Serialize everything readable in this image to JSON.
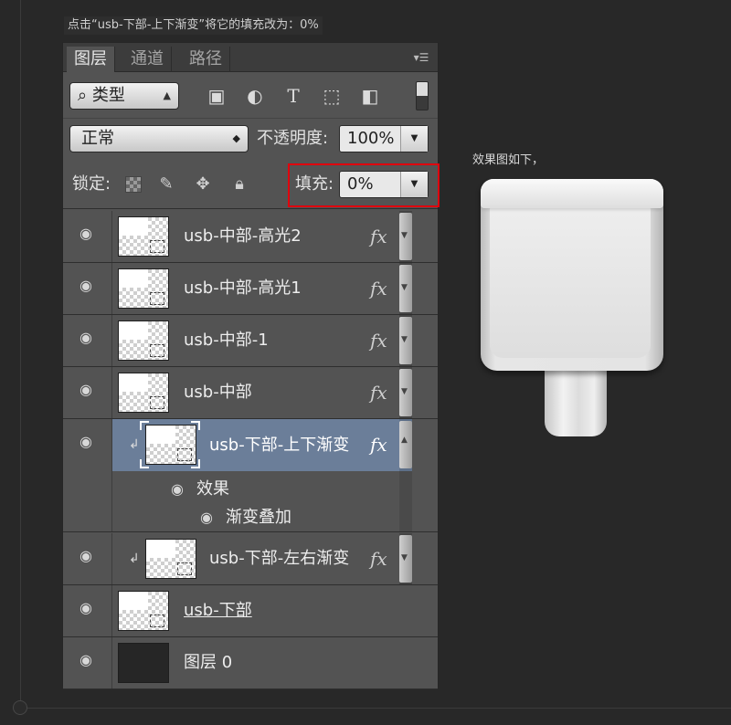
{
  "caption": "点击“usb-下部-上下渐变”将它的填充改为：0%",
  "panel": {
    "tabs": [
      "图层",
      "通道",
      "路径"
    ],
    "filter_kind": "类型",
    "blend_mode": "正常",
    "opacity_label": "不透明度:",
    "opacity_value": "100%",
    "lock_label": "锁定:",
    "fill_label": "填充:",
    "fill_value": "0%"
  },
  "layers": [
    {
      "name": "usb-中部-高光2",
      "fx": "fx"
    },
    {
      "name": "usb-中部-高光1",
      "fx": "fx"
    },
    {
      "name": "usb-中部-1",
      "fx": "fx"
    },
    {
      "name": "usb-中部",
      "fx": "fx"
    },
    {
      "name": "usb-下部-上下渐变",
      "fx": "fx",
      "selected": true
    },
    {
      "name": "usb-下部-左右渐变",
      "fx": "fx"
    },
    {
      "name": "usb-下部"
    },
    {
      "name": "图层 0"
    }
  ],
  "effects": {
    "group_label": "效果",
    "item_label": "渐变叠加"
  },
  "result_label": "效果图如下，",
  "colors": {
    "panel_bg": "#535353",
    "selected_row": "#6b7e99",
    "highlight_box": "#e0000d",
    "canvas_bg": "#282828"
  }
}
